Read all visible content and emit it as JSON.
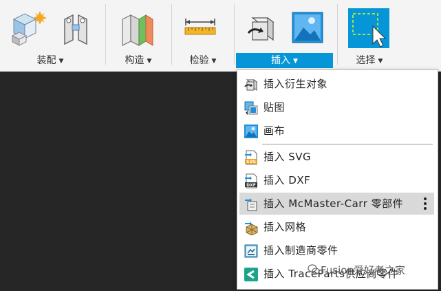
{
  "toolbar": {
    "groups": [
      {
        "label": "装配"
      },
      {
        "label": "构造"
      },
      {
        "label": "检验"
      },
      {
        "label": "插入"
      },
      {
        "label": "选择"
      }
    ],
    "active_group": "插入",
    "accent_color": "#0696d7"
  },
  "insert_menu": {
    "items": [
      {
        "label": "插入衍生对象",
        "icon": "insert-derive-icon"
      },
      {
        "label": "贴图",
        "icon": "decal-icon"
      },
      {
        "label": "画布",
        "icon": "canvas-icon"
      },
      {
        "label": "插入 SVG",
        "icon": "svg-file-icon"
      },
      {
        "label": "插入 DXF",
        "icon": "dxf-file-icon"
      },
      {
        "label": "插入 McMaster-Carr 零部件",
        "icon": "mcmaster-icon"
      },
      {
        "label": "插入网格",
        "icon": "mesh-icon"
      },
      {
        "label": "插入制造商零件",
        "icon": "manufacturer-part-icon"
      },
      {
        "label": "插入 TraceParts供应商零件",
        "icon": "traceparts-icon"
      }
    ]
  },
  "watermark": {
    "text": "Fusion爱好者之家"
  }
}
